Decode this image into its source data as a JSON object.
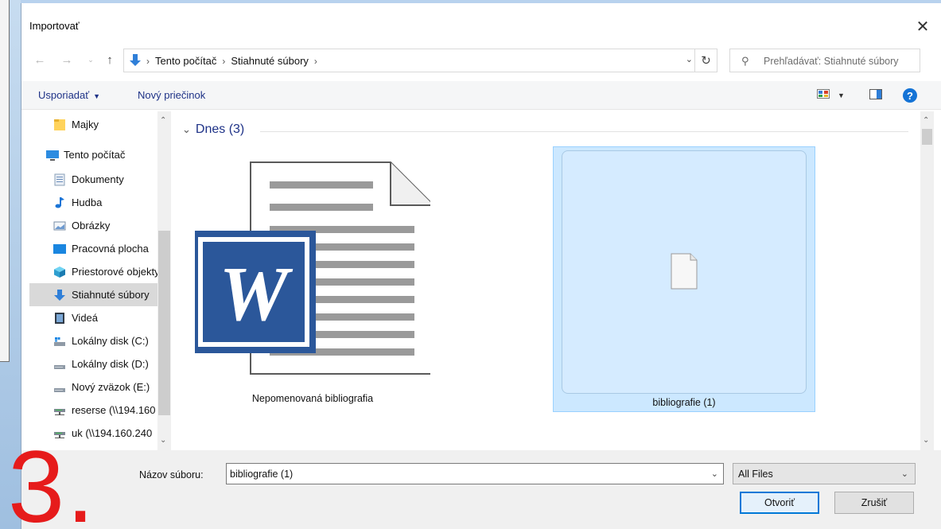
{
  "dialog": {
    "title": "Importovať",
    "close_icon": "close-icon"
  },
  "nav": {
    "back_icon": "arrow-left-icon",
    "forward_icon": "arrow-right-icon",
    "recent_icon": "chevron-down-icon",
    "up_icon": "arrow-up-icon",
    "breadcrumb": [
      "Tento počítač",
      "Stiahnuté súbory"
    ],
    "refresh_icon": "refresh-icon",
    "search_placeholder": "Prehľadávať: Stiahnuté súbory"
  },
  "toolbar": {
    "organize_label": "Usporiadať",
    "new_folder_label": "Nový priečinok",
    "help_label": "?"
  },
  "sidebar": {
    "items": [
      {
        "label": "Majky",
        "icon": "folder-icon"
      },
      {
        "label": "Tento počítač",
        "icon": "computer-icon"
      },
      {
        "label": "Dokumenty",
        "icon": "documents-icon"
      },
      {
        "label": "Hudba",
        "icon": "music-icon"
      },
      {
        "label": "Obrázky",
        "icon": "pictures-icon"
      },
      {
        "label": "Pracovná plocha",
        "icon": "desktop-icon"
      },
      {
        "label": "Priestorové objekty",
        "icon": "3d-objects-icon"
      },
      {
        "label": "Stiahnuté súbory",
        "icon": "download-icon"
      },
      {
        "label": "Videá",
        "icon": "video-icon"
      },
      {
        "label": "Lokálny disk (C:)",
        "icon": "system-drive-icon"
      },
      {
        "label": "Lokálny disk (D:)",
        "icon": "drive-icon"
      },
      {
        "label": "Nový zväzok (E:)",
        "icon": "drive-icon"
      },
      {
        "label": "reserse (\\\\194.160",
        "icon": "network-drive-icon"
      },
      {
        "label": "uk (\\\\194.160.240",
        "icon": "network-drive-icon"
      }
    ],
    "selected_index": 7
  },
  "content": {
    "group_label": "Dnes (3)",
    "files": [
      {
        "name": "Nepomenovaná bibliografia",
        "icon": "word-document-icon",
        "selected": false
      },
      {
        "name": "bibliografie (1)",
        "icon": "blank-file-icon",
        "selected": true
      }
    ]
  },
  "footer": {
    "filename_label": "Názov súboru:",
    "filename_value": "bibliografie (1)",
    "filter_value": "All Files",
    "open_label": "Otvoriť",
    "cancel_label": "Zrušiť"
  },
  "annotation": {
    "step_number": "3.",
    "color": "#e61b1b"
  }
}
